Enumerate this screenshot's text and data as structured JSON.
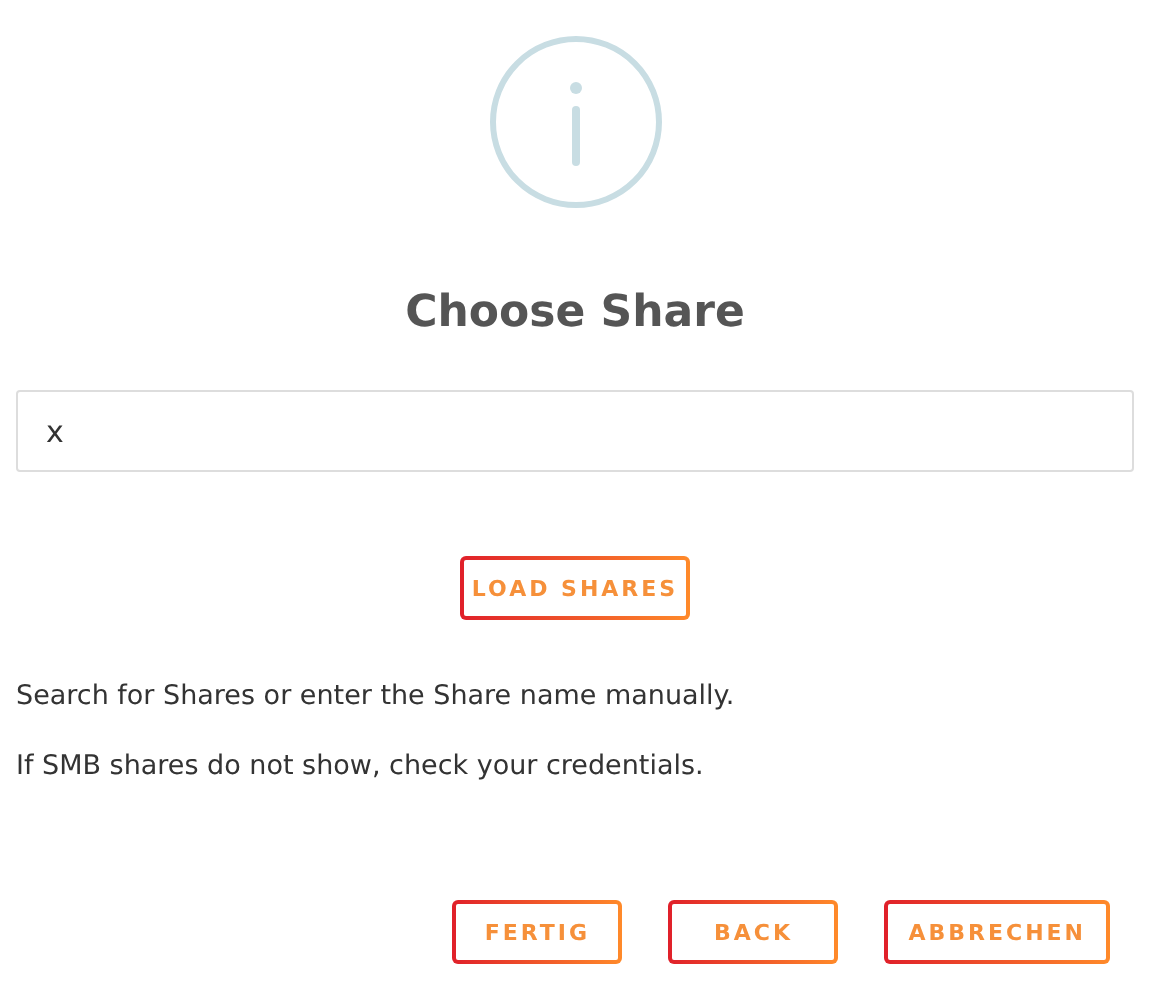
{
  "dialog": {
    "title": "Choose Share"
  },
  "share_field": {
    "value": "x"
  },
  "load_button": {
    "label": "LOAD SHARES"
  },
  "messages": [
    "Search for Shares or enter the Share name manually.",
    "If SMB shares do not show, check your credentials."
  ],
  "buttons": [
    "FERTIG",
    "BACK",
    "ABBRECHEN"
  ]
}
